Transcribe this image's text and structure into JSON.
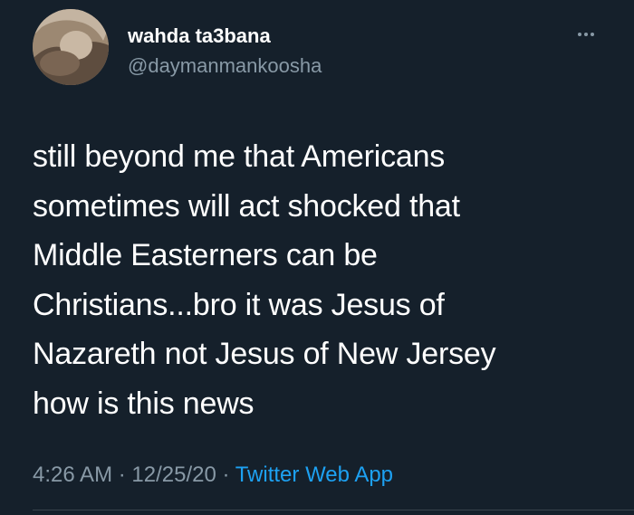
{
  "tweet": {
    "author": {
      "display_name": "wahda ta3bana",
      "handle": "@daymanmankoosha",
      "avatar_icon": "avatar-photo"
    },
    "more_icon": "more-options-icon",
    "text_lines": [
      "still beyond me that Americans",
      "sometimes will act shocked that",
      "Middle Easterners can be",
      "Christians...bro it was Jesus of",
      "Nazareth not Jesus of New Jersey",
      "how is this news"
    ],
    "time": "4:26 AM",
    "separator": " · ",
    "date": "12/25/20",
    "source": "Twitter Web App"
  },
  "colors": {
    "background": "#15202b",
    "text": "#ffffff",
    "secondary": "#8899a6",
    "link": "#1da1f2",
    "divider": "#38444d"
  }
}
